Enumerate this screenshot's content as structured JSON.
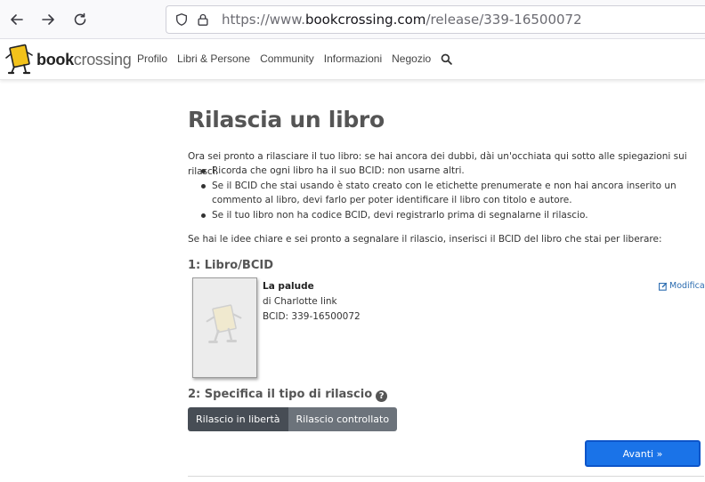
{
  "browser": {
    "url_prefix": "https://www.",
    "url_host": "bookcrossing.com",
    "url_path": "/release/339-16500072"
  },
  "site": {
    "logo_part1": "book",
    "logo_part2": "crossing",
    "nav": [
      "Profilo",
      "Libri & Persone",
      "Community",
      "Informazioni",
      "Negozio"
    ]
  },
  "page": {
    "title": "Rilascia un libro",
    "intro": "Ora sei pronto a rilasciare il tuo libro: se hai ancora dei dubbi, dài un'occhiata qui sotto alle spiegazioni sui rilasci.",
    "bullets": [
      "Ricorda che ogni libro ha il suo BCID: non usarne altri.",
      "Se il BCID che stai usando è stato creato con le etichette prenumerate e non hai ancora inserito un commento al libro, devi farlo per poter identificare il libro con titolo e autore.",
      "Se il tuo libro non ha codice BCID, devi registrarlo prima di segnalarne il rilascio."
    ],
    "prompt": "Se hai le idee chiare e sei pronto a segnalare il rilascio, inserisci il BCID del libro che stai per liberare:",
    "section1": "1: Libro/BCID",
    "book": {
      "title": "La palude",
      "author": "di Charlotte link",
      "bcid": "BCID: 339-16500072"
    },
    "edit_label": "Modifica",
    "section2": "2: Specifica il tipo di rilascio",
    "help_glyph": "?",
    "release_options": [
      "Rilascio in libertà",
      "Rilascio controllato"
    ],
    "next_label": "Avanti »"
  },
  "colors": {
    "primary_button": "#1a73e8",
    "link": "#2b6cb0",
    "toggle_active": "#474d55",
    "toggle_inactive": "#6c737b",
    "logo_yellow": "#f2c21b"
  }
}
